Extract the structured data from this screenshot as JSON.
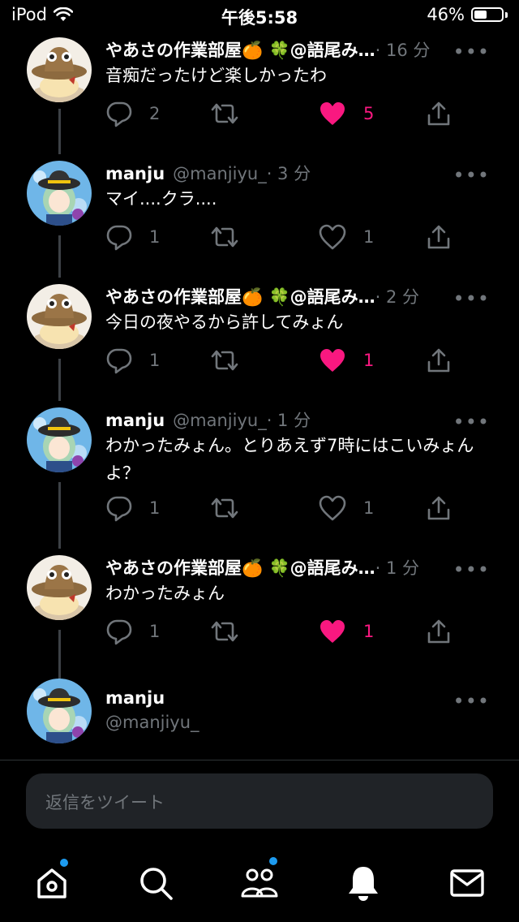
{
  "status_bar": {
    "carrier": "iPod",
    "time": "午後5:58",
    "battery": "46%",
    "battery_level": 0.46
  },
  "tweets": [
    {
      "name": "やあさの作業部屋🍊 🍀@語尾み…",
      "handle": "",
      "time": "· 16 分",
      "text": "音痴だったけど楽しかったわ",
      "replies": "2",
      "retweets": "",
      "likes": "5",
      "liked": true,
      "avatar": "hat-avatar"
    },
    {
      "name": "manju",
      "handle": "@manjiyu_",
      "time": "· 3 分",
      "text": "マイ....クラ....",
      "replies": "1",
      "retweets": "",
      "likes": "1",
      "liked": false,
      "avatar": "koishi-avatar"
    },
    {
      "name": "やあさの作業部屋🍊 🍀@語尾み…",
      "handle": "",
      "time": "· 2 分",
      "text": "今日の夜やるから許してみょん",
      "replies": "1",
      "retweets": "",
      "likes": "1",
      "liked": true,
      "avatar": "hat-avatar"
    },
    {
      "name": "manju",
      "handle": "@manjiyu_",
      "time": "· 1 分",
      "text": "わかったみょん。とりあえず7時にはこいみょんよ？",
      "replies": "1",
      "retweets": "",
      "likes": "1",
      "liked": false,
      "avatar": "koishi-avatar"
    },
    {
      "name": "やあさの作業部屋🍊 🍀@語尾み…",
      "handle": "",
      "time": "· 1 分",
      "text": "わかったみょん",
      "replies": "1",
      "retweets": "",
      "likes": "1",
      "liked": true,
      "avatar": "hat-avatar"
    }
  ],
  "last_tweet": {
    "name": "manju",
    "handle": "@manjiyu_"
  },
  "more_icon": "•••",
  "reply_box": {
    "placeholder": "返信をツイート"
  },
  "tabbar": {
    "items": [
      "home-icon",
      "search-icon",
      "communities-icon",
      "notifications-icon",
      "messages-icon"
    ]
  },
  "colors": {
    "like": "#f91880",
    "muted": "#71767b",
    "accent": "#1d9bf0"
  }
}
